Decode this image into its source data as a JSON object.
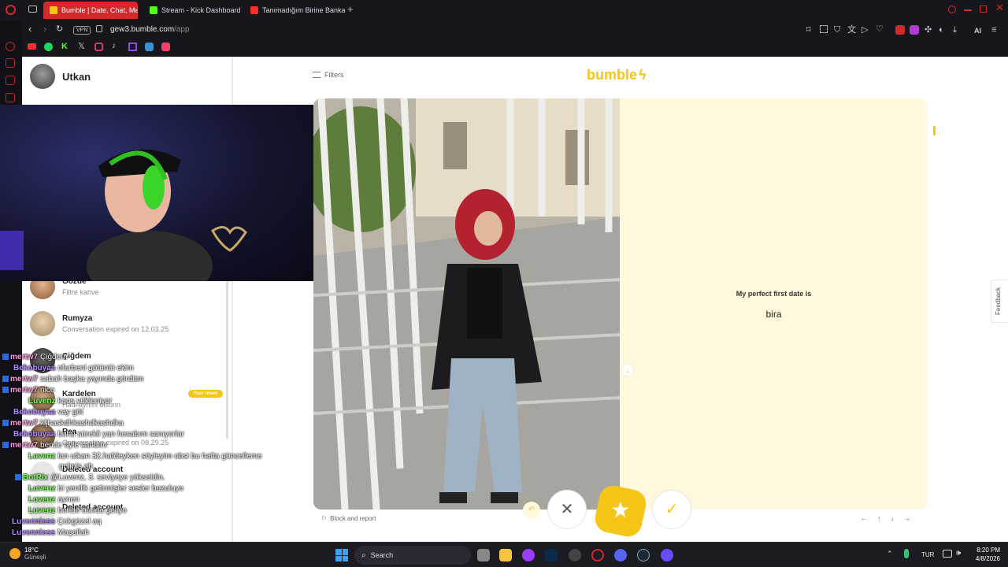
{
  "browser": {
    "tabs": [
      {
        "label": "Bumble | Date, Chat, Meet",
        "active": true,
        "color": "#f5c518"
      },
      {
        "label": "Stream - Kick Dashboard",
        "active": false,
        "color": "#53fc18"
      },
      {
        "label": "Tanımadığım Birine Banka",
        "active": false,
        "color": "#ff2d2d"
      }
    ],
    "new_tab": "+",
    "url_host": "gew3.bumble.com",
    "url_path": "/app",
    "vpn": "VPN",
    "ai_label": "AI",
    "bookmarks": [
      "youtube-icon",
      "spotify-icon",
      "kick-icon",
      "x-icon",
      "instagram-icon",
      "tiktok-icon",
      "twitch-icon",
      "app-icon",
      "stream-icon"
    ]
  },
  "bumble": {
    "user_name": "Utkan",
    "filters_label": "Filters",
    "logo": "bumble",
    "conversations": [
      {
        "name": "Gözde",
        "sub": "Filtre kahve",
        "badge": ""
      },
      {
        "name": "Rumyza",
        "sub": "Conversation expired on 12.03.25",
        "badge": ""
      },
      {
        "name": "Çiğdem",
        "sub": "",
        "badge": ""
      },
      {
        "name": "Kardelen",
        "sub": "Hadi aynıni olsunn",
        "badge": "Your move"
      },
      {
        "name": "Rea",
        "sub": "Conversation expired on 08.29.25",
        "badge": ""
      },
      {
        "name": "Deleted account",
        "sub": "",
        "badge": ""
      },
      {
        "name": "Deleted account",
        "sub": "",
        "badge": ""
      }
    ],
    "profile": {
      "prompt_title": "My perfect first date is",
      "prompt_answer": "bira"
    },
    "block_report": "Block and report",
    "actions": {
      "undo": "undo",
      "pass": "✕",
      "superswipe": "★",
      "like": "✓"
    },
    "feedback": "Feedback",
    "keys": [
      "←",
      "↑",
      "↓",
      "→"
    ]
  },
  "chat_overlay": [
    {
      "user": "mertw7",
      "msg": "Çiğdem",
      "color": "#ff9de0",
      "icon": true
    },
    {
      "user": "Bekobuyaa",
      "msg": "ofurbeni götüntü ekim",
      "color": "#b48cff",
      "icon": false
    },
    {
      "user": "mertw7",
      "msg": "sabah başka yayında gördüm",
      "color": "#ff9de0",
      "icon": true
    },
    {
      "user": "mertw7",
      "msg": "nice",
      "color": "#ff9de0",
      "icon": true
    },
    {
      "user": "Luvenz",
      "msg": "kaos yükleniyor",
      "color": "#7dff5a",
      "icon": false
    },
    {
      "user": "Bekobuyaa",
      "msg": "vay göt",
      "color": "#b48cff",
      "icon": false
    },
    {
      "user": "mertw7",
      "msg": "kljhaskdhkashdkashdka",
      "color": "#ff9de0",
      "icon": true
    },
    {
      "user": "Bekobuyaa",
      "msg": "bunu sürekli yan hesabım sanıyorlar",
      "color": "#b48cff",
      "icon": false
    },
    {
      "user": "mertw7",
      "msg": "bende öyle sandım",
      "color": "#ff9de0",
      "icon": true
    },
    {
      "user": "Luvenz",
      "msg": "lan utkan 32.hafdeyken söyleyim obsi bu hafta güncelleme",
      "color": "#7dff5a",
      "icon": false
    },
    {
      "user": "",
      "msg": "gelmiş ab",
      "color": "#ffffff",
      "icon": false
    },
    {
      "user": "BotRix",
      "msg": "@Luvenz, 3. seviyeye yükseldin.",
      "color": "#7dff5a",
      "icon": true
    },
    {
      "user": "Luvenz",
      "msg": "bi yenilik getirmişler sesler bozuluyo",
      "color": "#7dff5a",
      "icon": false
    },
    {
      "user": "Luvenz",
      "msg": "aynen",
      "color": "#7dff5a",
      "icon": false
    },
    {
      "user": "Luvenz",
      "msg": "bende bunda geliyo",
      "color": "#7dff5a",
      "icon": false
    },
    {
      "user": "Luvenniess",
      "msg": "Çokgüzel aq",
      "color": "#b48cff",
      "icon": false
    },
    {
      "user": "Luvenniess",
      "msg": "Maşallah",
      "color": "#b48cff",
      "icon": false
    }
  ],
  "taskbar": {
    "weather_temp": "18°C",
    "weather_desc": "Güneşli",
    "search_label": "Search",
    "language": "TUR",
    "time": "8:20 PM",
    "date": "4/8/2026"
  },
  "colors": {
    "bumble_yellow": "#f5c518",
    "card_bg": "#fff8dc",
    "opera_red": "#d22a2a"
  }
}
